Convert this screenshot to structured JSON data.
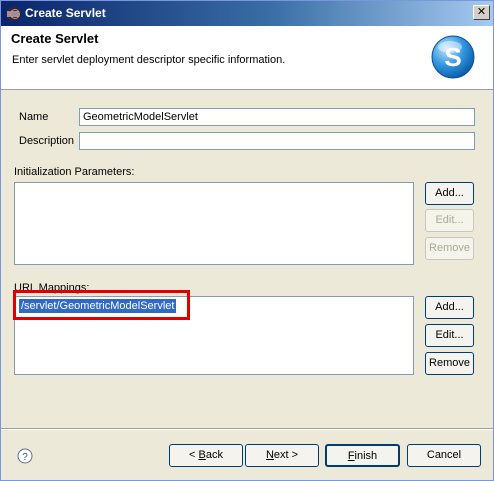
{
  "window": {
    "title": "Create Servlet",
    "close_glyph": "✕"
  },
  "header": {
    "title": "Create Servlet",
    "description": "Enter servlet deployment descriptor specific information.",
    "logo_letter": "S"
  },
  "form": {
    "name_label": "Name",
    "name_value": "GeometricModelServlet",
    "description_label": "Description",
    "description_value": ""
  },
  "init_params": {
    "label": "Initialization Parameters:",
    "add": "Add...",
    "edit": "Edit...",
    "remove": "Remove"
  },
  "url_mappings": {
    "label": "URL Mappings:",
    "items": [
      "/servlet/GeometricModelServlet"
    ],
    "add": "Add...",
    "edit": "Edit...",
    "remove": "Remove"
  },
  "footer": {
    "back": {
      "prefix": "< ",
      "key": "B",
      "rest": "ack"
    },
    "next": {
      "key": "N",
      "rest": "ext >"
    },
    "finish": {
      "key": "F",
      "rest": "inish"
    },
    "cancel": "Cancel",
    "help_glyph": "?"
  },
  "colors": {
    "selection": "#316ac5",
    "highlight_box": "#e00000",
    "titlebar": "#0a246a"
  }
}
